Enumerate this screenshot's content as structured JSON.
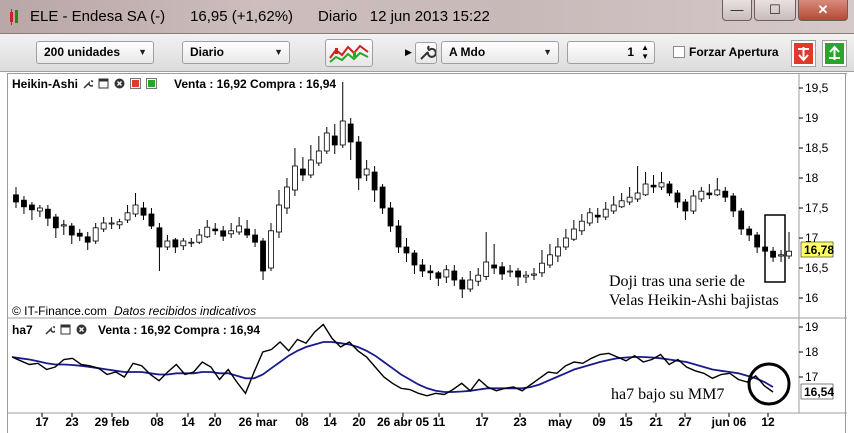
{
  "window": {
    "title": "ELE - Endesa SA (-)      16,95 (+1,62%)      Diario   12 jun 2013 15:22",
    "minimize_glyph": "—",
    "maximize_glyph": "☐",
    "close_glyph": "✕"
  },
  "toolbar": {
    "units_value": "200 unidades",
    "period_value": "Diario",
    "order_type_value": "A Mdo",
    "quantity_value": "1",
    "force_open_label": "Forzar Apertura",
    "force_open_checked": false
  },
  "main_panel": {
    "indicator_name": "Heikin-Ashi",
    "quote": "Venta : 16,92 Compra : 16,94",
    "price_axis_ticks": [
      "19,5",
      "19",
      "18,5",
      "18",
      "17,5",
      "17",
      "16,5",
      "16"
    ],
    "last_price_tag": "16,78",
    "copyright": "© IT-Finance.com",
    "data_notice": "Datos recibidos indicativos",
    "annotation_line1": "Doji tras una serie de",
    "annotation_line2": "Velas Heikin-Ashi bajistas",
    "up_candle_color": "#ffffff",
    "down_candle_color": "#000000",
    "tag_color": "#ffff66"
  },
  "sub_panel": {
    "indicator_name": "ha7",
    "quote": "Venta : 16,92 Compra : 16,94",
    "axis_ticks": [
      "19",
      "18",
      "17"
    ],
    "last_value_tag": "16,54",
    "annotation": "ha7 bajo su MM7",
    "ha7_color": "#000000",
    "mm7_color": "#1a1a8c"
  },
  "date_axis": {
    "labels": [
      "17",
      "23",
      "29 feb",
      "08",
      "14",
      "20",
      "26 mar",
      "08",
      "14",
      "20",
      "26 abr 05",
      "11",
      "17",
      "23",
      "may",
      "09",
      "15",
      "21",
      "27",
      "jun 06",
      "12"
    ]
  },
  "chart_data": {
    "type": "candlestick",
    "title": "Heikin-Ashi",
    "ylim": [
      15.8,
      19.7
    ],
    "candles": [
      [
        17.72,
        17.6,
        17.85,
        17.5
      ],
      [
        17.63,
        17.52,
        17.7,
        17.4
      ],
      [
        17.55,
        17.47,
        17.6,
        17.3
      ],
      [
        17.45,
        17.5,
        17.55,
        17.35
      ],
      [
        17.48,
        17.33,
        17.55,
        17.2
      ],
      [
        17.35,
        17.17,
        17.4,
        17.0
      ],
      [
        17.2,
        17.22,
        17.3,
        17.05
      ],
      [
        17.2,
        17.05,
        17.25,
        16.9
      ],
      [
        17.08,
        17.03,
        17.15,
        16.95
      ],
      [
        17.02,
        16.93,
        17.1,
        16.8
      ],
      [
        16.95,
        17.17,
        17.25,
        16.9
      ],
      [
        17.15,
        17.25,
        17.35,
        17.1
      ],
      [
        17.25,
        17.25,
        17.35,
        17.15
      ],
      [
        17.22,
        17.27,
        17.32,
        17.15
      ],
      [
        17.3,
        17.42,
        17.55,
        17.25
      ],
      [
        17.4,
        17.55,
        17.75,
        17.35
      ],
      [
        17.5,
        17.38,
        17.6,
        17.3
      ],
      [
        17.4,
        17.2,
        17.5,
        17.15
      ],
      [
        17.17,
        16.85,
        17.25,
        16.45
      ],
      [
        16.85,
        16.95,
        17.05,
        16.8
      ],
      [
        16.97,
        16.85,
        17.0,
        16.75
      ],
      [
        16.87,
        16.95,
        17.0,
        16.8
      ],
      [
        16.92,
        16.93,
        17.0,
        16.85
      ],
      [
        16.93,
        17.05,
        17.15,
        16.9
      ],
      [
        17.02,
        17.18,
        17.3,
        17.0
      ],
      [
        17.15,
        17.12,
        17.25,
        17.05
      ],
      [
        17.12,
        17.03,
        17.2,
        16.95
      ],
      [
        17.07,
        17.12,
        17.25,
        17.0
      ],
      [
        17.1,
        17.2,
        17.35,
        17.05
      ],
      [
        17.15,
        17.05,
        17.3,
        17.0
      ],
      [
        17.05,
        16.93,
        17.15,
        16.85
      ],
      [
        16.95,
        16.45,
        17.0,
        16.3
      ],
      [
        16.5,
        17.12,
        17.25,
        16.45
      ],
      [
        17.1,
        17.55,
        17.8,
        17.0
      ],
      [
        17.5,
        17.85,
        18.0,
        17.4
      ],
      [
        17.8,
        18.2,
        18.5,
        17.7
      ],
      [
        18.15,
        18.05,
        18.35,
        17.95
      ],
      [
        18.05,
        18.3,
        18.55,
        18.0
      ],
      [
        18.25,
        18.45,
        18.7,
        18.2
      ],
      [
        18.45,
        18.75,
        18.85,
        18.4
      ],
      [
        18.7,
        18.55,
        18.9,
        18.4
      ],
      [
        18.55,
        18.95,
        19.6,
        18.5
      ],
      [
        18.9,
        18.6,
        19.0,
        18.3
      ],
      [
        18.6,
        18.0,
        18.7,
        17.8
      ],
      [
        18.05,
        18.15,
        18.3,
        17.95
      ],
      [
        18.1,
        17.8,
        18.2,
        17.6
      ],
      [
        17.85,
        17.5,
        17.9,
        17.4
      ],
      [
        17.5,
        17.2,
        17.6,
        17.1
      ],
      [
        17.2,
        16.85,
        17.3,
        16.75
      ],
      [
        16.85,
        16.75,
        17.0,
        16.6
      ],
      [
        16.75,
        16.55,
        16.8,
        16.4
      ],
      [
        16.55,
        16.45,
        16.65,
        16.35
      ],
      [
        16.45,
        16.42,
        16.55,
        16.3
      ],
      [
        16.42,
        16.33,
        16.45,
        16.2
      ],
      [
        16.35,
        16.47,
        16.55,
        16.25
      ],
      [
        16.45,
        16.3,
        16.55,
        16.2
      ],
      [
        16.3,
        16.15,
        16.35,
        16.0
      ],
      [
        16.15,
        16.3,
        16.45,
        16.1
      ],
      [
        16.28,
        16.38,
        16.5,
        16.2
      ],
      [
        16.36,
        16.6,
        17.1,
        16.3
      ],
      [
        16.55,
        16.5,
        16.9,
        16.4
      ],
      [
        16.52,
        16.4,
        16.6,
        16.3
      ],
      [
        16.45,
        16.45,
        16.55,
        16.35
      ],
      [
        16.45,
        16.35,
        16.5,
        16.2
      ],
      [
        16.35,
        16.38,
        16.45,
        16.25
      ],
      [
        16.38,
        16.4,
        16.5,
        16.3
      ],
      [
        16.42,
        16.58,
        16.8,
        16.35
      ],
      [
        16.55,
        16.72,
        16.9,
        16.5
      ],
      [
        16.7,
        16.85,
        17.0,
        16.6
      ],
      [
        16.85,
        17.0,
        17.15,
        16.8
      ],
      [
        16.98,
        17.15,
        17.3,
        16.95
      ],
      [
        17.12,
        17.28,
        17.4,
        17.05
      ],
      [
        17.25,
        17.42,
        17.5,
        17.2
      ],
      [
        17.38,
        17.35,
        17.5,
        17.25
      ],
      [
        17.35,
        17.48,
        17.6,
        17.3
      ],
      [
        17.45,
        17.55,
        17.7,
        17.4
      ],
      [
        17.52,
        17.62,
        17.75,
        17.5
      ],
      [
        17.6,
        17.68,
        17.85,
        17.55
      ],
      [
        17.65,
        17.75,
        18.2,
        17.6
      ],
      [
        17.72,
        17.9,
        18.1,
        17.7
      ],
      [
        17.88,
        17.85,
        18.05,
        17.75
      ],
      [
        17.85,
        17.92,
        18.1,
        17.8
      ],
      [
        17.9,
        17.75,
        17.95,
        17.7
      ],
      [
        17.75,
        17.6,
        17.8,
        17.5
      ],
      [
        17.6,
        17.45,
        17.65,
        17.3
      ],
      [
        17.45,
        17.7,
        17.8,
        17.4
      ],
      [
        17.65,
        17.78,
        17.85,
        17.6
      ],
      [
        17.75,
        17.72,
        17.9,
        17.65
      ],
      [
        17.72,
        17.8,
        18.0,
        17.7
      ],
      [
        17.78,
        17.68,
        17.85,
        17.6
      ],
      [
        17.7,
        17.45,
        17.75,
        17.35
      ],
      [
        17.45,
        17.15,
        17.5,
        17.05
      ],
      [
        17.15,
        17.05,
        17.2,
        16.95
      ],
      [
        17.05,
        16.85,
        17.1,
        16.75
      ],
      [
        16.85,
        16.78,
        16.9,
        16.7
      ],
      [
        16.78,
        16.68,
        16.85,
        16.6
      ],
      [
        16.7,
        16.72,
        16.8,
        16.6
      ],
      [
        16.7,
        16.78,
        17.1,
        16.65
      ]
    ],
    "ha7_series": [
      17.8,
      17.65,
      17.5,
      17.55,
      17.3,
      17.4,
      17.7,
      17.75,
      17.5,
      17.45,
      17.35,
      17.1,
      17.2,
      17.0,
      17.55,
      17.45,
      17.1,
      16.85,
      17.2,
      17.5,
      17.1,
      17.2,
      17.6,
      17.4,
      16.9,
      17.3,
      16.8,
      16.35,
      17.2,
      18.0,
      18.1,
      18.4,
      18.05,
      18.5,
      18.35,
      18.8,
      19.1,
      18.55,
      18.2,
      18.4,
      18.05,
      17.8,
      17.4,
      17.0,
      16.75,
      16.55,
      16.5,
      16.35,
      16.25,
      16.35,
      16.3,
      16.5,
      16.75,
      16.45,
      16.9,
      16.6,
      16.45,
      16.55,
      16.6,
      16.45,
      16.7,
      16.95,
      17.2,
      17.15,
      17.45,
      17.6,
      17.55,
      17.75,
      17.9,
      17.95,
      17.8,
      17.65,
      17.85,
      17.6,
      17.7,
      17.9,
      17.5,
      17.7,
      17.4,
      17.25,
      17.15,
      16.95,
      17.1,
      17.15,
      16.9,
      16.8,
      17.05,
      16.65,
      16.4
    ],
    "mm7_series": [
      17.8,
      17.75,
      17.7,
      17.63,
      17.55,
      17.5,
      17.5,
      17.48,
      17.45,
      17.4,
      17.35,
      17.3,
      17.25,
      17.2,
      17.2,
      17.2,
      17.15,
      17.1,
      17.1,
      17.15,
      17.15,
      17.15,
      17.2,
      17.2,
      17.15,
      17.15,
      17.05,
      16.95,
      16.95,
      17.1,
      17.35,
      17.6,
      17.85,
      18.05,
      18.2,
      18.3,
      18.4,
      18.4,
      18.35,
      18.3,
      18.2,
      18.05,
      17.85,
      17.6,
      17.35,
      17.1,
      16.9,
      16.7,
      16.55,
      16.45,
      16.4,
      16.4,
      16.42,
      16.45,
      16.5,
      16.55,
      16.55,
      16.55,
      16.55,
      16.55,
      16.6,
      16.7,
      16.85,
      17.0,
      17.15,
      17.3,
      17.4,
      17.5,
      17.6,
      17.68,
      17.75,
      17.78,
      17.8,
      17.8,
      17.78,
      17.75,
      17.7,
      17.65,
      17.6,
      17.5,
      17.4,
      17.3,
      17.25,
      17.2,
      17.15,
      17.05,
      16.95,
      16.8,
      16.6
    ]
  }
}
